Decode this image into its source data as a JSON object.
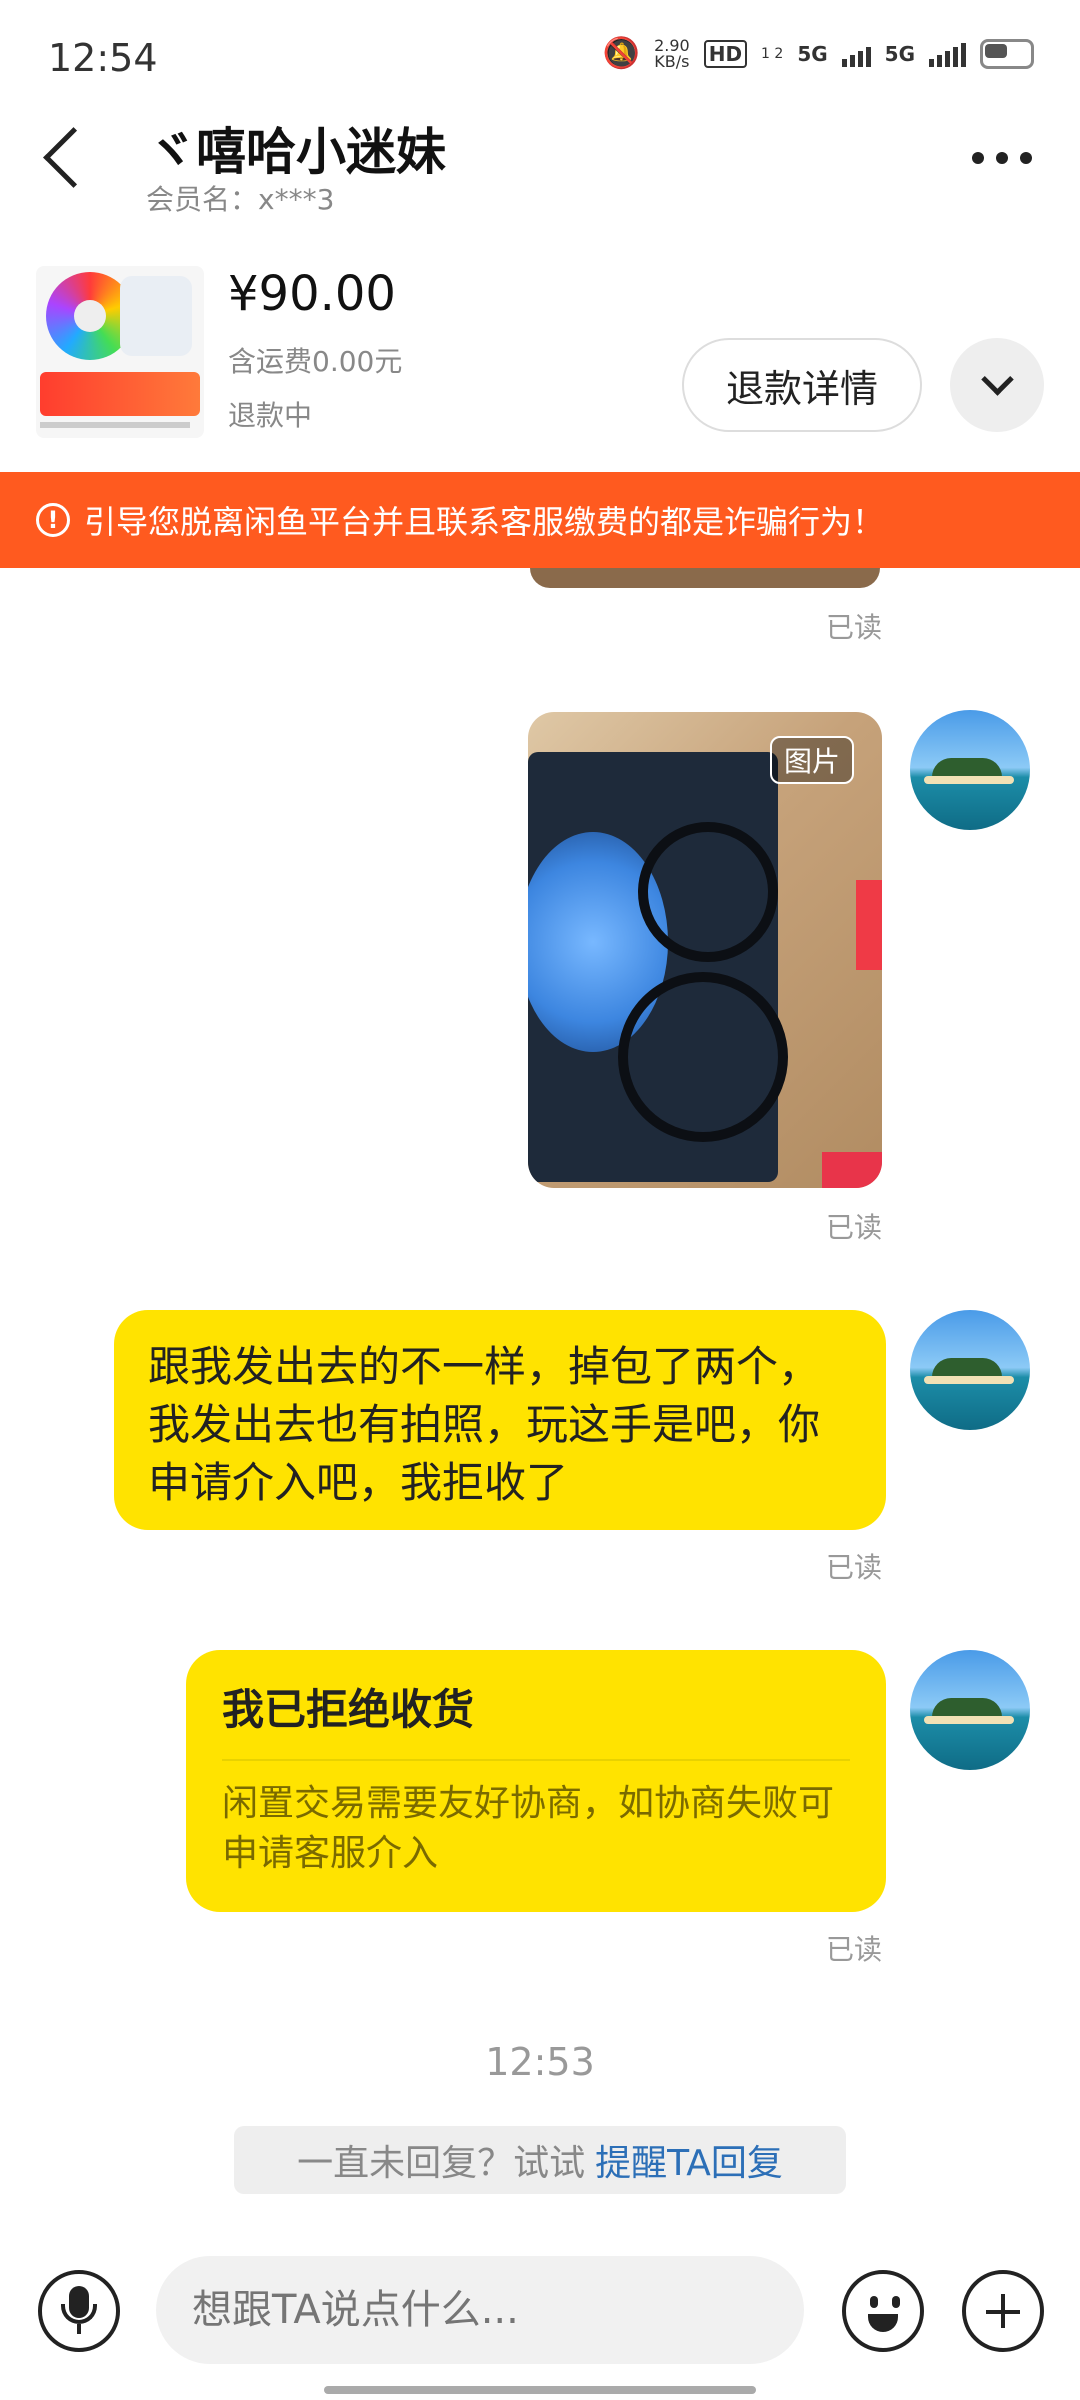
{
  "status_bar": {
    "time": "12:54",
    "net_speed_value": "2.90",
    "net_speed_unit": "KB/s",
    "hd": "HD",
    "hd_sub": "1 2",
    "net1": "5G",
    "net2": "5G"
  },
  "header": {
    "title": "ヾ嘻哈小迷妹",
    "member": "会员名：x***3"
  },
  "product": {
    "price": "¥90.00",
    "shipping": "含运费0.00元",
    "status": "退款中",
    "refund_button": "退款详情"
  },
  "warning": {
    "icon": "!",
    "text": "引导您脱离闲鱼平台并且联系客服缴费的都是诈骗行为！"
  },
  "chat": {
    "read_label": "已读",
    "image_tag": "图片",
    "message_text": "跟我发出去的不一样，掉包了两个，我发出去也有拍照，玩这手是吧，你申请介入吧，我拒收了",
    "card_title": "我已拒绝收货",
    "card_subtitle": "闲置交易需要友好协商，如协商失败可申请客服介入",
    "timestamp": "12:53",
    "nudge_text": "一直未回复？试试",
    "nudge_link": "提醒TA回复"
  },
  "input": {
    "placeholder": "想跟TA说点什么..."
  },
  "colors": {
    "bubble": "#ffe300",
    "warning": "#ff5a1f",
    "link": "#2c6fb7"
  }
}
